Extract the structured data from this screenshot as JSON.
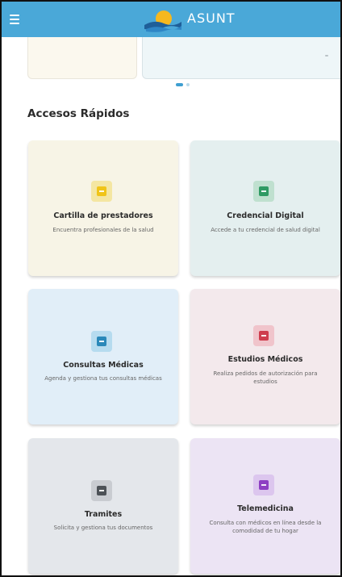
{
  "app": {
    "brand": "ASUNT"
  },
  "section": {
    "title": "Accesos Rápidos"
  },
  "cards": [
    {
      "title": "Cartilla de prestadores",
      "desc": "Encuentra profesionales de la salud",
      "icon": "medical-plus-icon"
    },
    {
      "title": "Credencial Digital",
      "desc": "Accede a tu credencial de salud digital",
      "icon": "credit-card-icon"
    },
    {
      "title": "Consultas Médicas",
      "desc": "Agenda y gestiona tus consultas médicas",
      "icon": "medical-bag-icon"
    },
    {
      "title": "Estudios Médicos",
      "desc": "Realiza pedidos de autorización para estudios",
      "icon": "folder-medical-icon"
    },
    {
      "title": "Tramites",
      "desc": "Solicita y gestiona tus documentos",
      "icon": "document-icon"
    },
    {
      "title": "Telemedicina",
      "desc": "Consulta con médicos en línea desde la comodidad de tu hogar",
      "icon": "video-medical-icon"
    }
  ],
  "colors": {
    "appbar": "#4aa8d8",
    "accent": "#3f9fd1"
  }
}
